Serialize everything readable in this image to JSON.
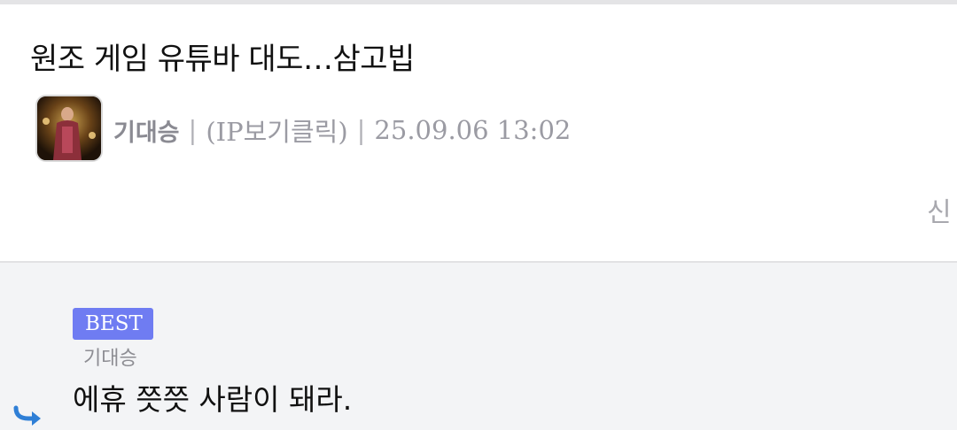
{
  "post": {
    "title": "원조 게임 유튜바 대도…삼고빕",
    "author": "기대승",
    "ip_link": "(IP보기클릭)",
    "separator": "|",
    "datetime": "25.09.06 13:02",
    "edge_text": "신"
  },
  "comments": [
    {
      "badge": "BEST",
      "author": "기대승",
      "text": "에휴 쯧쯧 사람이 돼라."
    }
  ],
  "icons": {
    "avatar": "author-avatar",
    "reply": "reply-arrow-icon"
  },
  "colors": {
    "best_badge": "#6f7cf2",
    "reply_icon": "#2f7fd6",
    "comment_bg": "#f3f4f6"
  }
}
